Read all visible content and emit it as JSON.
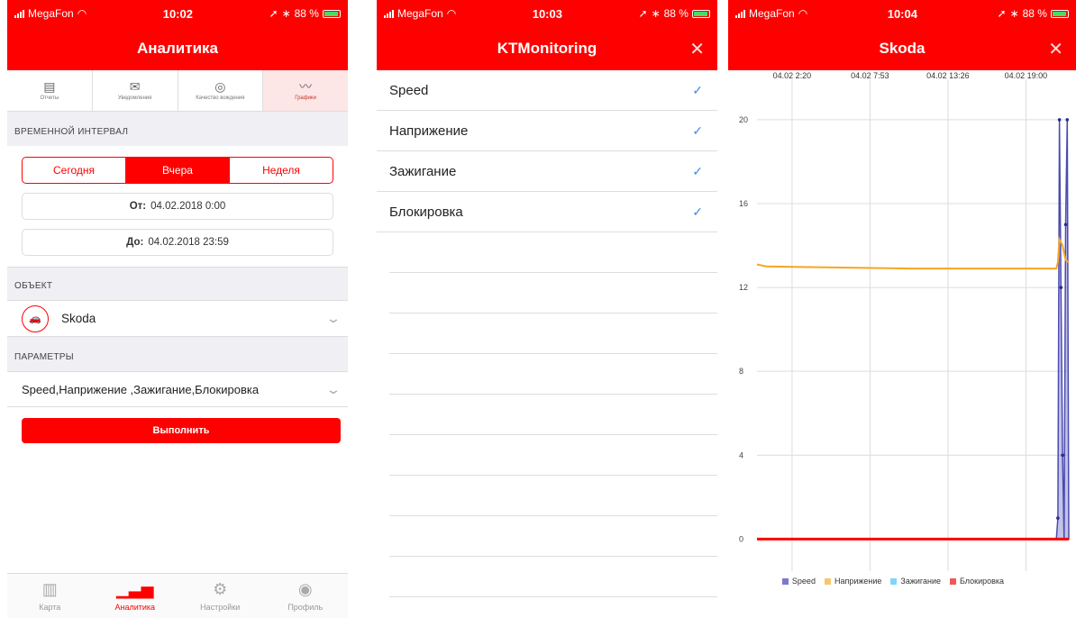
{
  "status": [
    {
      "carrier": "MegaFon",
      "time": "10:02",
      "battery": "88 %"
    },
    {
      "carrier": "MegaFon",
      "time": "10:03",
      "battery": "88 %"
    },
    {
      "carrier": "MegaFon",
      "time": "10:04",
      "battery": "88 %"
    }
  ],
  "analytics": {
    "title": "Аналитика",
    "tabs": [
      {
        "label": "Отчеты",
        "icon": "report-icon"
      },
      {
        "label": "Уведомления",
        "icon": "envelope-icon"
      },
      {
        "label": "Качество вождения",
        "icon": "steering-wheel-icon"
      },
      {
        "label": "Графики",
        "icon": "chart-icon"
      }
    ],
    "section_interval": "ВРЕМЕННОЙ ИНТЕРВАЛ",
    "range": [
      "Сегодня",
      "Вчера",
      "Неделя"
    ],
    "active_range": 1,
    "from_label": "От:",
    "from_value": "04.02.2018 0:00",
    "to_label": "До:",
    "to_value": "04.02.2018 23:59",
    "section_object": "ОБЪЕКТ",
    "object_name": "Skoda",
    "section_params": "ПАРАМЕТРЫ",
    "params_value": "Speed,Наприжение ,Зажигание,Блокировка",
    "run_label": "Выполнить"
  },
  "tabbar": [
    {
      "label": "Карта",
      "icon": "map-icon"
    },
    {
      "label": "Аналитика",
      "icon": "analytics-icon"
    },
    {
      "label": "Настройки",
      "icon": "gear-icon"
    },
    {
      "label": "Профиль",
      "icon": "profile-icon"
    }
  ],
  "active_tab": 1,
  "picker": {
    "title": "KTMonitoring",
    "close": "✕",
    "options": [
      "Speed",
      "Наприжение",
      "Зажигание",
      "Блокировка"
    ]
  },
  "chart_screen": {
    "title": "Skoda",
    "close": "✕"
  },
  "chart_data": {
    "type": "line",
    "x_tick_labels": [
      "04.02 2:20",
      "04.02 7:53",
      "04.02 13:26",
      "04.02 19:00"
    ],
    "y_ticks": [
      0,
      4,
      8,
      12,
      16,
      20
    ],
    "ylim": [
      -0.5,
      21.5
    ],
    "grid": true,
    "legend_position": "bottom",
    "series": [
      {
        "name": "Speed",
        "color": "#7a7acb",
        "points": [
          [
            0.0,
            0
          ],
          [
            0.96,
            0
          ],
          [
            0.965,
            1
          ],
          [
            0.97,
            20
          ],
          [
            0.975,
            12
          ],
          [
            0.98,
            4
          ],
          [
            0.985,
            0
          ],
          [
            0.99,
            15
          ],
          [
            0.995,
            20
          ],
          [
            1.0,
            0
          ]
        ]
      },
      {
        "name": "Наприжение",
        "color": "#f5a623",
        "points": [
          [
            0.0,
            13.1
          ],
          [
            0.03,
            13.0
          ],
          [
            0.5,
            12.9
          ],
          [
            0.55,
            12.9
          ],
          [
            0.96,
            12.9
          ],
          [
            0.965,
            13.2
          ],
          [
            0.97,
            14.3
          ],
          [
            0.98,
            14.0
          ],
          [
            0.99,
            13.3
          ],
          [
            1.0,
            13.2
          ]
        ]
      },
      {
        "name": "Зажигание",
        "color": "#7ed6f7",
        "points": []
      },
      {
        "name": "Блокировка",
        "color": "#ee5a5a",
        "points": [
          [
            0.0,
            0
          ],
          [
            1.0,
            0
          ]
        ]
      }
    ]
  }
}
